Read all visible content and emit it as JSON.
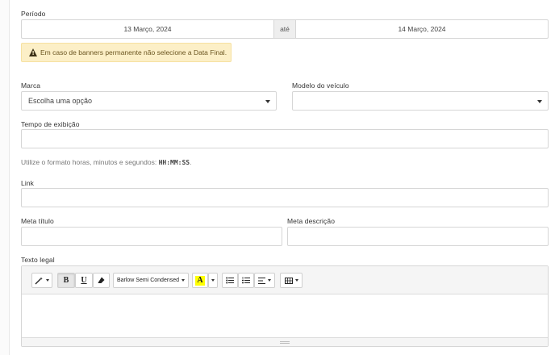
{
  "period": {
    "label": "Período",
    "start": "13 Março, 2024",
    "separator": "até",
    "end": "14 Março, 2024"
  },
  "alert": {
    "text": "Em caso de banners permanente não selecione a Data Final.",
    "icon": "warning-icon"
  },
  "brand": {
    "label": "Marca",
    "value": "Escolha uma opção"
  },
  "model": {
    "label": "Modelo do veículo",
    "value": ""
  },
  "display_time": {
    "label": "Tempo de exibição",
    "value": "",
    "hint_prefix": "Utilize o formato horas, minutos e segundos: ",
    "hint_format": "HH:MM:SS",
    "hint_suffix": "."
  },
  "link": {
    "label": "Link",
    "value": ""
  },
  "meta_title": {
    "label": "Meta título",
    "value": ""
  },
  "meta_description": {
    "label": "Meta descrição",
    "value": ""
  },
  "legal_text": {
    "label": "Texto legal",
    "toolbar": {
      "bold": "B",
      "underline": "U",
      "font_name": "Barlow Semi Condensed",
      "color_letter": "A",
      "color_highlight": "#ffff00"
    },
    "content": ""
  }
}
